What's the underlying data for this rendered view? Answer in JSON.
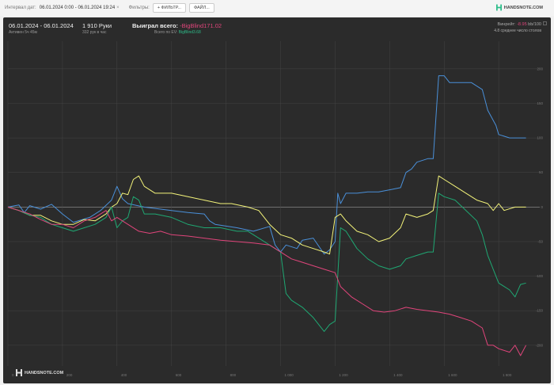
{
  "topbar": {
    "interval_label": "Интервал дат:",
    "interval_value": "06.01.2024 0:00 - 06.01.2024 19:24",
    "clear_icon": "close-icon",
    "filters_label": "Фильтры:",
    "filter_button": "+ ФИЛЬТР...",
    "file_button": "ФАЙЛ...",
    "brand": "HANDSNOTE.COM"
  },
  "summary": {
    "date_range": "06.01.2024 - 06.01.2024",
    "active": "Активен 5ч 45м",
    "hands": "1 910 Руки",
    "hands_per_hour": "332 рук в час",
    "won_label": "Выиграл всего:",
    "won_value": "-BigBlind171.02",
    "ev_label": "Всего по EV:",
    "ev_value": "BigBlind3.68",
    "winrate_label": "Винрейт:",
    "winrate_value": "-8.95",
    "winrate_unit": "bb/100",
    "avg_tables": "4.8 среднее число столов"
  },
  "footer": {
    "brand": "HANDSNOTE.COM"
  },
  "colors": {
    "background": "#2b2b2b",
    "blue": "#4a90d9",
    "yellow": "#f4f47a",
    "green": "#1fa873",
    "red": "#e0457b",
    "grid": "#444444"
  },
  "chart_data": {
    "type": "line",
    "xlim": [
      0,
      1910
    ],
    "ylim": [
      -230,
      240
    ],
    "x_ticks": [
      0,
      200,
      400,
      600,
      800,
      1000,
      1200,
      1400,
      1600,
      1800
    ],
    "x_tick_labels": [
      "0",
      "200",
      "400",
      "600",
      "800",
      "1 000",
      "1 200",
      "1 400",
      "1 600",
      "1 800"
    ],
    "y_ticks": [
      -200,
      -150,
      -100,
      -50,
      0,
      50,
      100,
      150,
      200
    ],
    "y_tick_labels": [
      "-200",
      "-150",
      "-100",
      "-50",
      "0",
      "50",
      "100",
      "150",
      "200"
    ],
    "grid": true,
    "series": [
      {
        "color": "#4a90d9",
        "points": [
          [
            0,
            0
          ],
          [
            40,
            3
          ],
          [
            60,
            -8
          ],
          [
            80,
            2
          ],
          [
            120,
            -3
          ],
          [
            160,
            4
          ],
          [
            200,
            -10
          ],
          [
            240,
            -22
          ],
          [
            300,
            -15
          ],
          [
            340,
            -5
          ],
          [
            380,
            10
          ],
          [
            400,
            30
          ],
          [
            420,
            12
          ],
          [
            440,
            5
          ],
          [
            500,
            0
          ],
          [
            540,
            -2
          ],
          [
            600,
            -5
          ],
          [
            660,
            -8
          ],
          [
            720,
            -10
          ],
          [
            740,
            -20
          ],
          [
            760,
            -25
          ],
          [
            840,
            -30
          ],
          [
            900,
            -35
          ],
          [
            960,
            -28
          ],
          [
            980,
            -55
          ],
          [
            1000,
            -65
          ],
          [
            1020,
            -55
          ],
          [
            1060,
            -60
          ],
          [
            1080,
            -48
          ],
          [
            1120,
            -45
          ],
          [
            1160,
            -68
          ],
          [
            1180,
            -62
          ],
          [
            1200,
            -50
          ],
          [
            1210,
            20
          ],
          [
            1220,
            5
          ],
          [
            1240,
            20
          ],
          [
            1280,
            20
          ],
          [
            1320,
            22
          ],
          [
            1360,
            22
          ],
          [
            1400,
            25
          ],
          [
            1440,
            28
          ],
          [
            1460,
            50
          ],
          [
            1480,
            55
          ],
          [
            1500,
            65
          ],
          [
            1540,
            70
          ],
          [
            1560,
            70
          ],
          [
            1580,
            190
          ],
          [
            1600,
            190
          ],
          [
            1620,
            180
          ],
          [
            1700,
            180
          ],
          [
            1740,
            170
          ],
          [
            1760,
            140
          ],
          [
            1790,
            118
          ],
          [
            1800,
            105
          ],
          [
            1840,
            100
          ],
          [
            1900,
            100
          ]
        ]
      },
      {
        "color": "#f4f47a",
        "points": [
          [
            0,
            0
          ],
          [
            40,
            -5
          ],
          [
            80,
            -12
          ],
          [
            120,
            -12
          ],
          [
            160,
            -20
          ],
          [
            200,
            -25
          ],
          [
            240,
            -25
          ],
          [
            280,
            -18
          ],
          [
            320,
            -20
          ],
          [
            360,
            -10
          ],
          [
            380,
            0
          ],
          [
            400,
            5
          ],
          [
            420,
            20
          ],
          [
            440,
            18
          ],
          [
            460,
            40
          ],
          [
            480,
            45
          ],
          [
            500,
            30
          ],
          [
            540,
            20
          ],
          [
            600,
            20
          ],
          [
            660,
            15
          ],
          [
            720,
            10
          ],
          [
            780,
            5
          ],
          [
            820,
            5
          ],
          [
            880,
            0
          ],
          [
            920,
            -5
          ],
          [
            960,
            -25
          ],
          [
            1000,
            -40
          ],
          [
            1040,
            -45
          ],
          [
            1080,
            -55
          ],
          [
            1120,
            -60
          ],
          [
            1160,
            -65
          ],
          [
            1180,
            -68
          ],
          [
            1200,
            -15
          ],
          [
            1220,
            -10
          ],
          [
            1240,
            -20
          ],
          [
            1280,
            -35
          ],
          [
            1320,
            -40
          ],
          [
            1360,
            -50
          ],
          [
            1400,
            -45
          ],
          [
            1440,
            -30
          ],
          [
            1460,
            -10
          ],
          [
            1500,
            -15
          ],
          [
            1540,
            -10
          ],
          [
            1560,
            -5
          ],
          [
            1580,
            45
          ],
          [
            1600,
            40
          ],
          [
            1640,
            30
          ],
          [
            1680,
            20
          ],
          [
            1720,
            10
          ],
          [
            1760,
            5
          ],
          [
            1780,
            -5
          ],
          [
            1800,
            5
          ],
          [
            1820,
            -5
          ],
          [
            1860,
            0
          ],
          [
            1900,
            0
          ]
        ]
      },
      {
        "color": "#1fa873",
        "points": [
          [
            0,
            0
          ],
          [
            40,
            -5
          ],
          [
            80,
            -12
          ],
          [
            120,
            -15
          ],
          [
            160,
            -25
          ],
          [
            200,
            -30
          ],
          [
            240,
            -35
          ],
          [
            280,
            -30
          ],
          [
            320,
            -25
          ],
          [
            360,
            -15
          ],
          [
            380,
            0
          ],
          [
            400,
            -30
          ],
          [
            420,
            -20
          ],
          [
            440,
            -15
          ],
          [
            460,
            15
          ],
          [
            480,
            10
          ],
          [
            500,
            -10
          ],
          [
            540,
            -10
          ],
          [
            600,
            -15
          ],
          [
            660,
            -25
          ],
          [
            720,
            -30
          ],
          [
            780,
            -30
          ],
          [
            840,
            -35
          ],
          [
            880,
            -35
          ],
          [
            920,
            -45
          ],
          [
            960,
            -55
          ],
          [
            1000,
            -65
          ],
          [
            1020,
            -125
          ],
          [
            1040,
            -135
          ],
          [
            1080,
            -145
          ],
          [
            1120,
            -160
          ],
          [
            1160,
            -180
          ],
          [
            1180,
            -170
          ],
          [
            1200,
            -165
          ],
          [
            1220,
            -30
          ],
          [
            1240,
            -35
          ],
          [
            1280,
            -60
          ],
          [
            1320,
            -75
          ],
          [
            1360,
            -85
          ],
          [
            1400,
            -90
          ],
          [
            1440,
            -85
          ],
          [
            1460,
            -75
          ],
          [
            1500,
            -70
          ],
          [
            1540,
            -65
          ],
          [
            1560,
            -65
          ],
          [
            1580,
            20
          ],
          [
            1600,
            15
          ],
          [
            1640,
            10
          ],
          [
            1680,
            -5
          ],
          [
            1720,
            -20
          ],
          [
            1740,
            -40
          ],
          [
            1760,
            -70
          ],
          [
            1780,
            -90
          ],
          [
            1800,
            -110
          ],
          [
            1840,
            -120
          ],
          [
            1860,
            -130
          ],
          [
            1880,
            -112
          ],
          [
            1900,
            -110
          ]
        ]
      },
      {
        "color": "#e0457b",
        "points": [
          [
            0,
            0
          ],
          [
            40,
            -5
          ],
          [
            80,
            -10
          ],
          [
            120,
            -18
          ],
          [
            160,
            -25
          ],
          [
            200,
            -25
          ],
          [
            240,
            -30
          ],
          [
            280,
            -20
          ],
          [
            320,
            -15
          ],
          [
            360,
            -5
          ],
          [
            380,
            -20
          ],
          [
            400,
            -15
          ],
          [
            440,
            -25
          ],
          [
            480,
            -35
          ],
          [
            520,
            -38
          ],
          [
            560,
            -35
          ],
          [
            600,
            -40
          ],
          [
            660,
            -42
          ],
          [
            720,
            -45
          ],
          [
            780,
            -48
          ],
          [
            840,
            -50
          ],
          [
            900,
            -52
          ],
          [
            960,
            -55
          ],
          [
            1000,
            -65
          ],
          [
            1040,
            -75
          ],
          [
            1080,
            -80
          ],
          [
            1120,
            -85
          ],
          [
            1160,
            -90
          ],
          [
            1200,
            -95
          ],
          [
            1220,
            -115
          ],
          [
            1260,
            -130
          ],
          [
            1300,
            -140
          ],
          [
            1340,
            -150
          ],
          [
            1380,
            -152
          ],
          [
            1420,
            -150
          ],
          [
            1460,
            -145
          ],
          [
            1500,
            -148
          ],
          [
            1540,
            -150
          ],
          [
            1580,
            -152
          ],
          [
            1620,
            -155
          ],
          [
            1660,
            -160
          ],
          [
            1700,
            -165
          ],
          [
            1740,
            -175
          ],
          [
            1760,
            -200
          ],
          [
            1780,
            -200
          ],
          [
            1800,
            -205
          ],
          [
            1840,
            -210
          ],
          [
            1860,
            -200
          ],
          [
            1880,
            -215
          ],
          [
            1900,
            -200
          ]
        ]
      }
    ]
  }
}
